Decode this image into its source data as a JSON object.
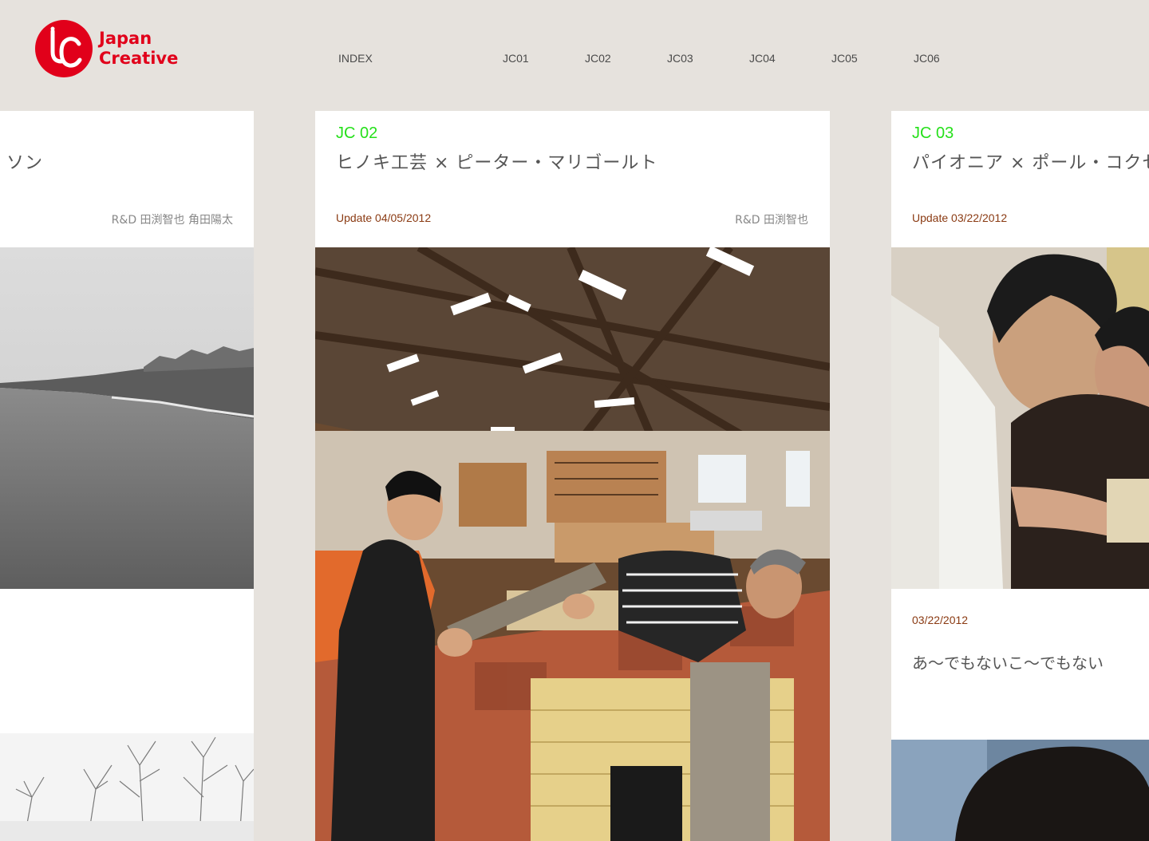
{
  "brand": {
    "line1": "Japan",
    "line2": "Creative",
    "color": "#e1001a"
  },
  "nav": {
    "index": "INDEX",
    "items": [
      "JC01",
      "JC02",
      "JC03",
      "JC04",
      "JC05",
      "JC06"
    ]
  },
  "cards": {
    "left": {
      "title_fragment": "ソン",
      "credit": "R&D 田渕智也 角田陽太"
    },
    "middle": {
      "series": "JC 02",
      "title": "ヒノキ工芸 × ピーター・マリゴールト",
      "update": "Update 04/05/2012",
      "credit": "R&D 田渕智也"
    },
    "right": {
      "series": "JC 03",
      "title": "パイオニア × ポール・コクセ",
      "update": "Update 03/22/2012",
      "sub_date": "03/22/2012",
      "sub_title": "あ〜でもないこ〜でもない"
    }
  },
  "colors": {
    "background": "#e6e2dd",
    "series_green": "#25e01a",
    "date_brown": "#8a3a12"
  }
}
